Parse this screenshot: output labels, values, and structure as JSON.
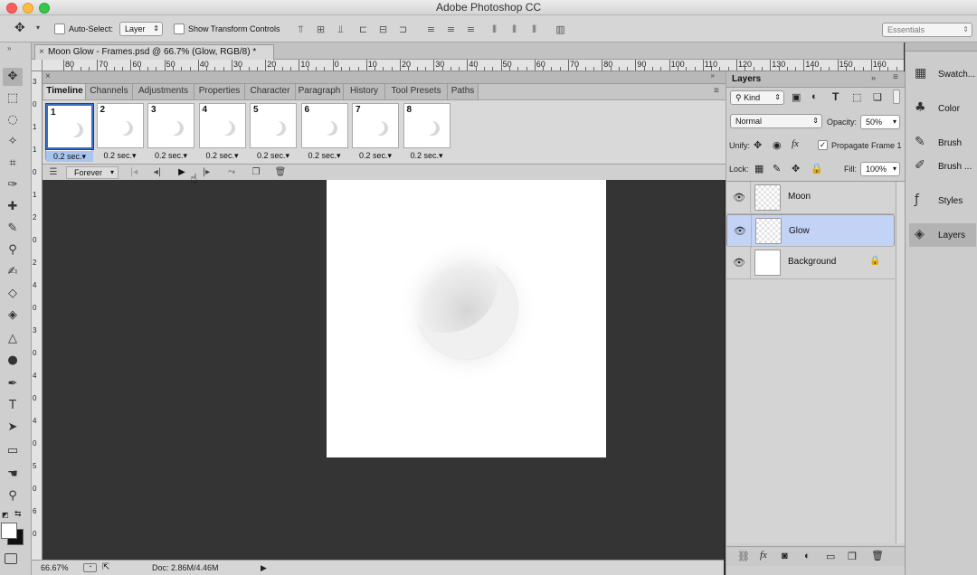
{
  "app": {
    "title": "Adobe Photoshop CC"
  },
  "options": {
    "auto_select_label": "Auto-Select:",
    "auto_select_target": "Layer",
    "show_transform_label": "Show Transform Controls",
    "workspace": "Essentials"
  },
  "document": {
    "tab_label": "Moon Glow - Frames.psd @ 66.7% (Glow, RGB/8) *"
  },
  "ruler": {
    "h_labels": [
      "80",
      "70",
      "60",
      "50",
      "40",
      "30",
      "20",
      "10",
      "0",
      "10",
      "20",
      "30",
      "40",
      "50",
      "60",
      "70",
      "80",
      "90",
      "100",
      "110",
      "120",
      "130",
      "140",
      "150",
      "160"
    ],
    "v_labels": [
      "3",
      "0",
      "1",
      "1",
      "0",
      "1",
      "2",
      "0",
      "2",
      "4",
      "0",
      "3",
      "0",
      "4",
      "0",
      "4",
      "0",
      "5",
      "0",
      "6",
      "0"
    ]
  },
  "panel": {
    "tabs": [
      "Timeline",
      "Channels",
      "Adjustments",
      "Properties",
      "Character",
      "Paragraph",
      "History",
      "Tool Presets",
      "Paths"
    ],
    "active_tab": "Timeline"
  },
  "timeline": {
    "frames": [
      {
        "num": "1",
        "delay": "0.2 sec.",
        "selected": true
      },
      {
        "num": "2",
        "delay": "0.2 sec."
      },
      {
        "num": "3",
        "delay": "0.2 sec."
      },
      {
        "num": "4",
        "delay": "0.2 sec."
      },
      {
        "num": "5",
        "delay": "0.2 sec."
      },
      {
        "num": "6",
        "delay": "0.2 sec."
      },
      {
        "num": "7",
        "delay": "0.2 sec."
      },
      {
        "num": "8",
        "delay": "0.2 sec."
      }
    ],
    "loop": "Forever"
  },
  "layers_panel": {
    "title": "Layers",
    "filter": "Kind",
    "blend_mode": "Normal",
    "opacity_label": "Opacity:",
    "opacity": "50%",
    "unify_label": "Unify:",
    "propagate_label": "Propagate Frame 1",
    "lock_label": "Lock:",
    "fill_label": "Fill:",
    "fill": "100%",
    "layers": [
      {
        "name": "Moon"
      },
      {
        "name": "Glow",
        "selected": true
      },
      {
        "name": "Background",
        "locked": true
      }
    ]
  },
  "dock": {
    "items": [
      {
        "label": "Swatch...",
        "icon": "swatches-icon"
      },
      {
        "label": "Color",
        "icon": "color-icon"
      },
      {
        "label": "Brush",
        "icon": "brush-icon"
      },
      {
        "label": "Brush ...",
        "icon": "brush-presets-icon"
      },
      {
        "label": "Styles",
        "icon": "styles-icon"
      },
      {
        "label": "Layers",
        "icon": "layers-icon",
        "active": true
      }
    ]
  },
  "status": {
    "zoom": "66.67%",
    "doc": "Doc: 2.86M/4.46M"
  },
  "colors": {
    "accent": "#3b6fc4",
    "selected_layer": "#c3d3f5",
    "canvas_bg": "#343434"
  }
}
